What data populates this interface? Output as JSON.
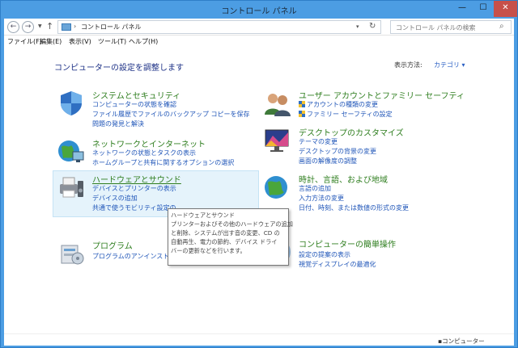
{
  "window": {
    "title": "コントロール パネル",
    "controls": {
      "minimize": "—",
      "maximize": "☐",
      "close": "✕"
    }
  },
  "address": {
    "path": "コントロール パネル",
    "separator": "›",
    "search_placeholder": "コントロール パネルの検索"
  },
  "menu": [
    "ファイル(F)",
    "編集(E)",
    "表示(V)",
    "ツール(T)",
    "ヘルプ(H)"
  ],
  "header": {
    "title": "コンピューターの設定を調整します",
    "viewby_label": "表示方法:",
    "viewby_value": "カテゴリ ▾"
  },
  "categories": [
    {
      "title": "システムとセキュリティ",
      "icon": "shield-icon",
      "links": [
        "コンピューターの状態を確認",
        "ファイル履歴でファイルのバックアップ コピーを保存",
        "問題の発見と解決"
      ]
    },
    {
      "title": "ネットワークとインターネット",
      "icon": "network-globe-icon",
      "links": [
        "ネットワークの状態とタスクの表示",
        "ホームグループと共有に関するオプションの選択"
      ]
    },
    {
      "title": "ハードウェアとサウンド",
      "icon": "printer-speaker-icon",
      "links": [
        "デバイスとプリンターの表示",
        "デバイスの追加",
        "共通で使うモビリティ設定の"
      ]
    },
    {
      "title": "プログラム",
      "icon": "programs-icon",
      "links": [
        "プログラムのアンインストール"
      ]
    },
    {
      "title": "ユーザー アカウントとファミリー セーフティ",
      "icon": "users-icon",
      "links": [
        "アカウントの種類の変更",
        "ファミリー セーフティの設定"
      ]
    },
    {
      "title": "デスクトップのカスタマイズ",
      "icon": "desktop-monitor-icon",
      "links": [
        "テーマの変更",
        "デスクトップの背景の変更",
        "画面の解像度の調整"
      ]
    },
    {
      "title": "時計、言語、および地域",
      "icon": "clock-globe-icon",
      "links": [
        "言語の追加",
        "入力方法の変更",
        "日付、時刻、または数値の形式の変更"
      ]
    },
    {
      "title": "コンピューターの簡単操作",
      "icon": "ease-of-access-icon",
      "links": [
        "設定の提案の表示",
        "視覚ディスプレイの最適化"
      ]
    }
  ],
  "tooltip": {
    "lines": [
      "ハードウェアとサウンド",
      "プリンターおよびその他のハードウェアの追加",
      "と削除、システムが出す音の変更、CD の",
      "自動再生、電力の節約、デバイス ドライ",
      "バーの更新などを行います。"
    ]
  },
  "status": {
    "text": "コンピューター"
  },
  "colors": {
    "accent": "#4c9de3",
    "link": "#1f55b8",
    "category_title": "#2d7d1d",
    "page_title": "#1e3287"
  }
}
